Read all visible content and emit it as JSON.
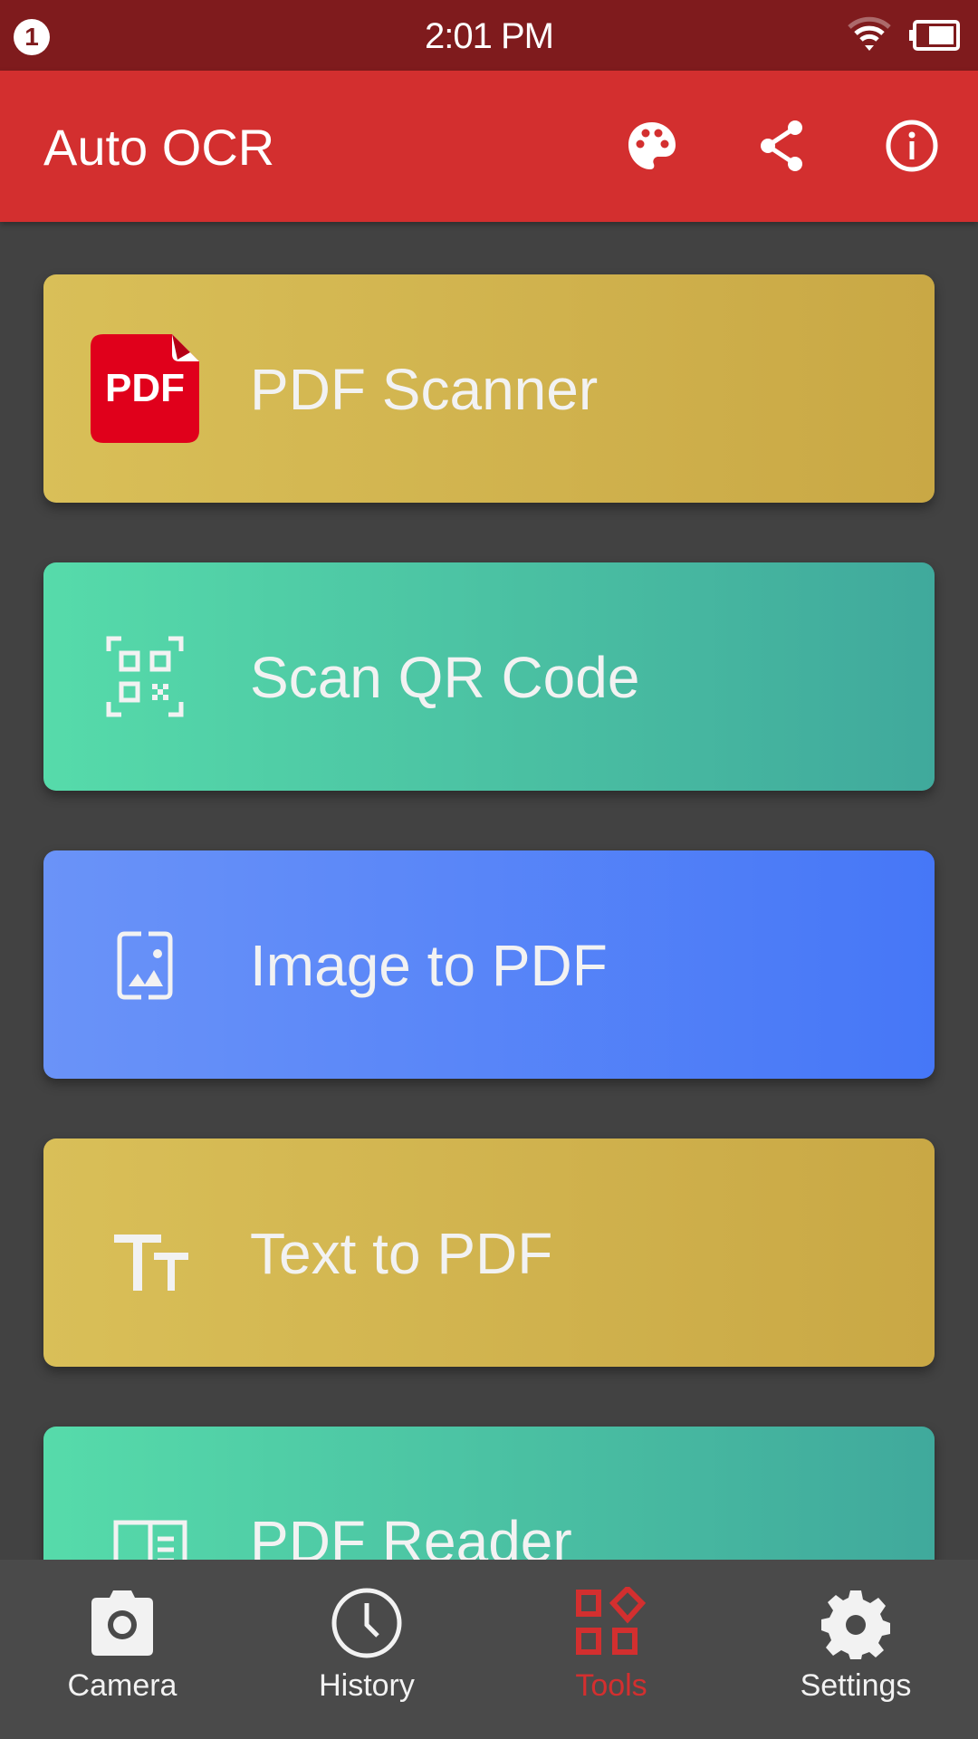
{
  "status_bar": {
    "notification_count": "1",
    "time": "2:01 PM",
    "wifi_icon": "wifi-icon",
    "battery_icon": "battery-icon"
  },
  "app_bar": {
    "title": "Auto OCR",
    "actions": [
      {
        "icon": "palette-icon",
        "label": "Theme"
      },
      {
        "icon": "share-icon",
        "label": "Share"
      },
      {
        "icon": "info-icon",
        "label": "About"
      }
    ]
  },
  "tools": [
    {
      "label": "PDF Scanner",
      "icon": "pdf-file-icon",
      "theme": "gold"
    },
    {
      "label": "Scan QR Code",
      "icon": "qr-scan-icon",
      "theme": "teal"
    },
    {
      "label": "Image to PDF",
      "icon": "image-frame-icon",
      "theme": "blue"
    },
    {
      "label": "Text to PDF",
      "icon": "text-size-icon",
      "theme": "gold"
    },
    {
      "label": "PDF Reader",
      "icon": "book-reader-icon",
      "theme": "teal"
    }
  ],
  "bottom_nav": {
    "active": "Tools",
    "items": [
      {
        "label": "Camera",
        "icon": "camera-icon"
      },
      {
        "label": "History",
        "icon": "clock-icon"
      },
      {
        "label": "Tools",
        "icon": "tools-grid-icon"
      },
      {
        "label": "Settings",
        "icon": "gear-icon"
      }
    ]
  },
  "colors": {
    "status_bar": "#7f1b1d",
    "app_bar": "#d32f2f",
    "background": "#424242",
    "bottom_nav": "#4a4a4a",
    "active_nav": "#d32f2f",
    "gold_card": "#d4b953",
    "teal_card": "#4fc7a5",
    "blue_card": "#5884f7",
    "pdf_badge": "#e0001b"
  }
}
